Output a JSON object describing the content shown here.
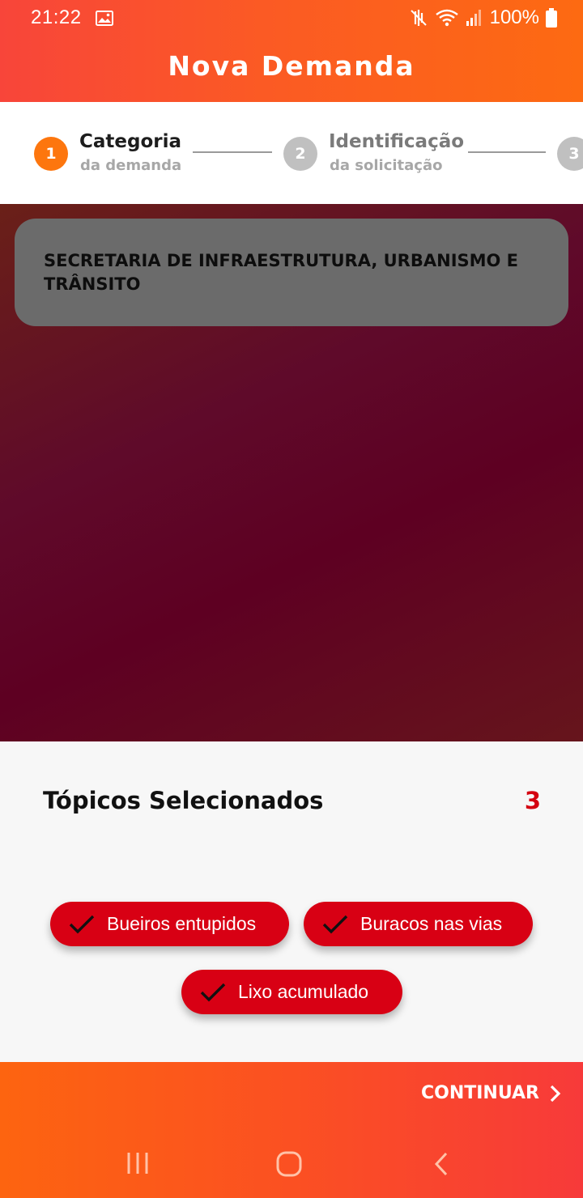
{
  "status_bar": {
    "time": "21:22",
    "battery": "100%"
  },
  "header": {
    "title": "Nova Demanda"
  },
  "stepper": {
    "steps": [
      {
        "number": "1",
        "title": "Categoria",
        "subtitle": "da demanda",
        "state": "active"
      },
      {
        "number": "2",
        "title": "Identificação",
        "subtitle": "da solicitação",
        "state": "inactive"
      },
      {
        "number": "3",
        "title": "",
        "subtitle": "",
        "state": "inactive"
      }
    ]
  },
  "category": {
    "name": "SECRETARIA DE INFRAESTRUTURA, URBANISMO E TRÂNSITO"
  },
  "topics": {
    "title": "Tópicos Selecionados",
    "count": "3",
    "items": [
      {
        "label": "Bueiros entupidos",
        "selected": true
      },
      {
        "label": "Buracos nas vias",
        "selected": true
      },
      {
        "label": "Lixo acumulado",
        "selected": true
      }
    ]
  },
  "actions": {
    "continue_label": "CONTINUAR"
  },
  "colors": {
    "accent_orange": "#fd760e",
    "chip_red": "#d80014",
    "count_red": "#d40010"
  },
  "icons": {
    "status": [
      "gallery-icon",
      "mute-icon",
      "wifi-icon",
      "signal-icon",
      "battery-icon"
    ],
    "chip": "check-icon",
    "continue": "chevron-right-icon",
    "nav": [
      "recents-icon",
      "home-icon",
      "back-icon"
    ]
  }
}
